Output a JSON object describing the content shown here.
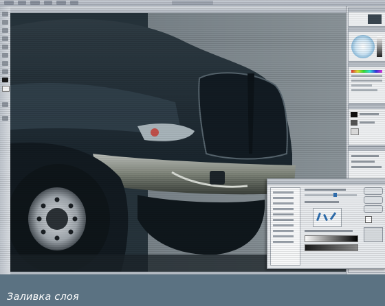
{
  "caption": {
    "text": "Заливка слоя"
  },
  "colors": {
    "caption_background": "#5b7282",
    "caption_text": "#ffffff",
    "canvas_backdrop": "#7a858c",
    "truck_body": "#1f2b33"
  },
  "screenshot": {
    "application_window": "image-editor",
    "open_dialog": "fill-layer-options",
    "subject_image": "truck-front"
  }
}
